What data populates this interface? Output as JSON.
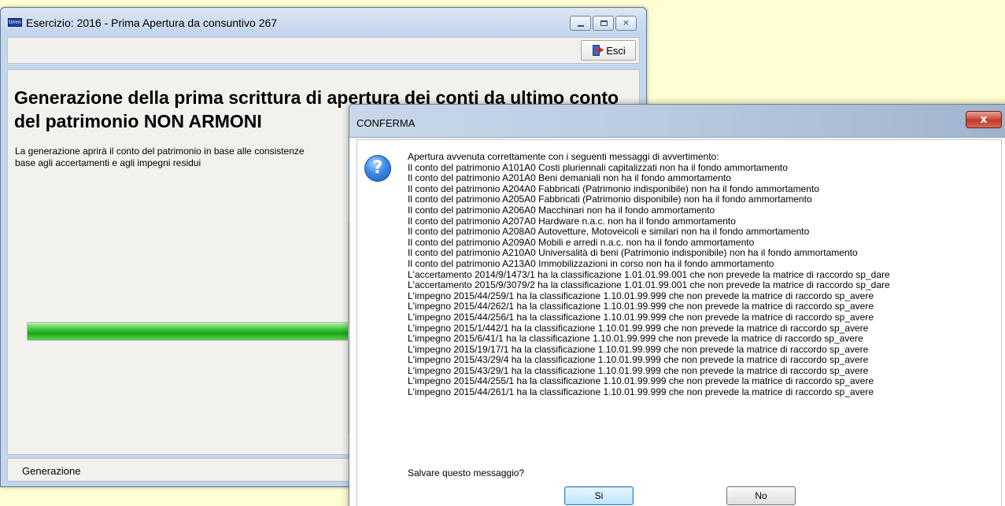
{
  "main_window": {
    "title": "Esercizio: 2016 - Prima Apertura da consuntivo 267",
    "app_icon_text": "timm",
    "toolbar": {
      "esci_label": "Esci"
    },
    "content": {
      "title": "Generazione della prima scrittura di apertura dei conti da ultimo conto del patrimonio NON ARMONI",
      "description": "La generazione aprirà il conto del patrimonio in base alle consistenze\nbase agli accertamenti e agli impegni residui",
      "progress_fraction": 1.0
    },
    "status": "Generazione"
  },
  "dialog": {
    "title": "CONFERMA",
    "close_label": "x",
    "icon_text": "?",
    "lines": [
      "Apertura avvenuta correttamente con i seguenti messaggi di avvertimento:",
      "Il conto del patrimonio A101A0 Costi pluriennali capitalizzati non ha il fondo ammortamento",
      "Il conto del patrimonio A201A0 Beni demaniali non ha il fondo ammortamento",
      "Il conto del patrimonio A204A0 Fabbricati (Patrimonio indisponibile) non ha il fondo ammortamento",
      "Il conto del patrimonio A205A0 Fabbricati (Patrimonio disponibile) non ha il fondo ammortamento",
      "Il conto del patrimonio A206A0 Macchinari non ha il fondo ammortamento",
      "Il conto del patrimonio A207A0 Hardware n.a.c. non ha il fondo ammortamento",
      "Il conto del patrimonio A208A0 Autovetture, Motoveicoli e similari non ha il fondo ammortamento",
      "Il conto del patrimonio A209A0 Mobili e arredi n.a.c. non ha il fondo ammortamento",
      "Il conto del patrimonio A210A0 Universalità di beni (Patrimonio indisponibile) non ha il fondo ammortamento",
      "Il conto del patrimonio A213A0 Immobilizzazioni in corso non ha il fondo ammortamento",
      "L'accertamento 2014/9/1473/1 ha la classificazione 1.01.01.99.001 che non prevede la matrice di raccordo sp_dare",
      "L'accertamento 2015/9/3079/2 ha la classificazione 1.01.01.99.001 che non prevede la matrice di raccordo sp_dare",
      "L'impegno 2015/44/259/1 ha la classificazione 1.10.01.99.999 che non prevede la matrice di raccordo sp_avere",
      "L'impegno 2015/44/262/1 ha la classificazione 1.10.01.99.999 che non prevede la matrice di raccordo sp_avere",
      "L'impegno 2015/44/256/1 ha la classificazione 1.10.01.99.999 che non prevede la matrice di raccordo sp_avere",
      "L'impegno 2015/1/442/1 ha la classificazione 1.10.01.99.999 che non prevede la matrice di raccordo sp_avere",
      "L'impegno 2015/6/41/1 ha la classificazione 1.10.01.99.999 che non prevede la matrice di raccordo sp_avere",
      "L'impegno 2015/19/17/1 ha la classificazione 1.10.01.99.999 che non prevede la matrice di raccordo sp_avere",
      "L'impegno 2015/43/29/4 ha la classificazione 1.10.01.99.999 che non prevede la matrice di raccordo sp_avere",
      "L'impegno 2015/43/29/1 ha la classificazione 1.10.01.99.999 che non prevede la matrice di raccordo sp_avere",
      "L'impegno 2015/44/255/1 ha la classificazione 1.10.01.99.999 che non prevede la matrice di raccordo sp_avere",
      "L'impegno 2015/44/261/1 ha la classificazione 1.10.01.99.999 che non prevede la matrice di raccordo sp_avere"
    ],
    "question": "Salvare questo messaggio?",
    "yes_label": "Si",
    "no_label": "No"
  }
}
